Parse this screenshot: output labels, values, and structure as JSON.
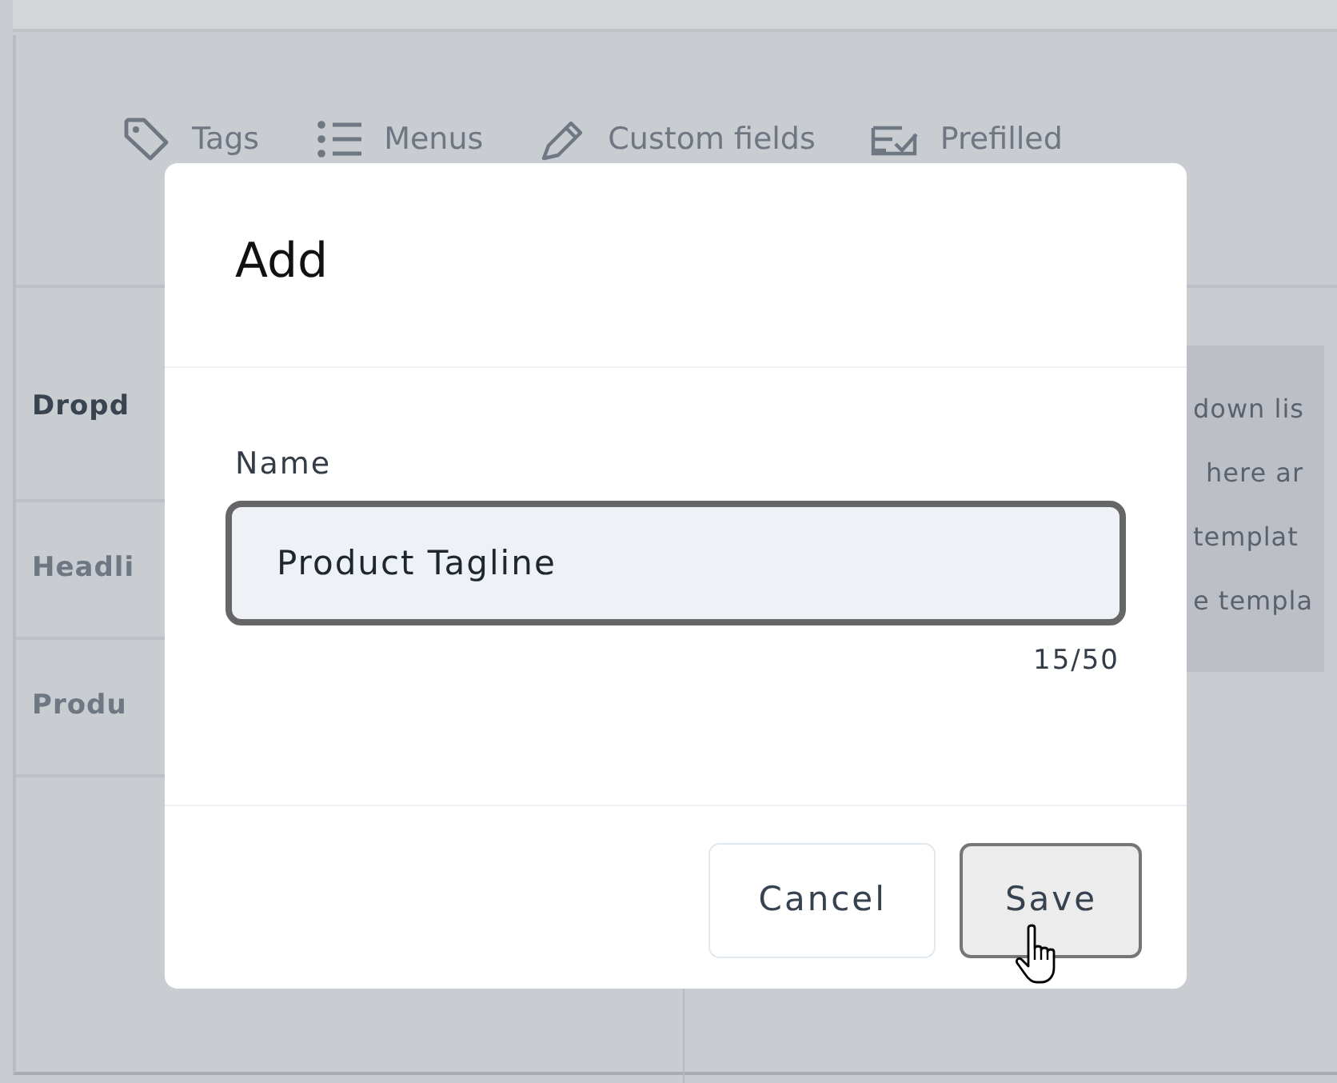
{
  "tabs": [
    {
      "label": "Tags"
    },
    {
      "label": "Menus"
    },
    {
      "label": "Custom fields"
    },
    {
      "label": "Prefilled"
    }
  ],
  "list": [
    {
      "label": "Dropd",
      "selected": true
    },
    {
      "label": "Headli",
      "selected": false
    },
    {
      "label": "Produ",
      "selected": false
    }
  ],
  "side_panel": {
    "lines": [
      "down lis",
      "here ar",
      "templat",
      "e templa"
    ]
  },
  "dialog": {
    "title": "Add",
    "field": {
      "label": "Name",
      "value": "Product Tagline",
      "counter": "15/50"
    },
    "buttons": [
      {
        "label": "Cancel",
        "hovered": false
      },
      {
        "label": "Save",
        "hovered": true
      }
    ]
  }
}
